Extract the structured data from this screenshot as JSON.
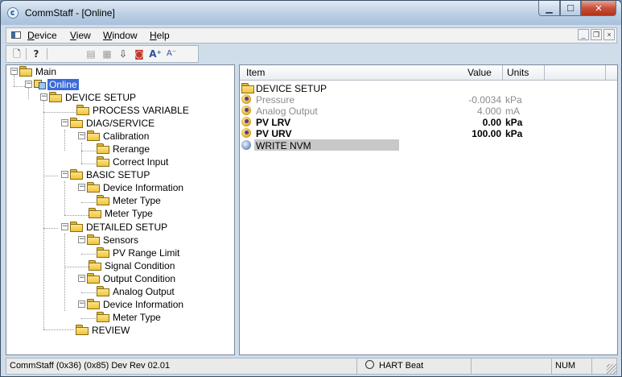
{
  "window": {
    "title": "CommStaff - [Online]"
  },
  "menubar": {
    "items": [
      "Device",
      "View",
      "Window",
      "Help"
    ]
  },
  "toolbar": {
    "buttons": [
      "new-icon",
      "help-icon",
      "read-icon",
      "write-icon",
      "download-icon",
      "red-device-icon",
      "font-larger-icon",
      "font-smaller-icon"
    ]
  },
  "tree": {
    "nodes": [
      {
        "label": "Main"
      },
      {
        "label": "Online"
      },
      {
        "label": "DEVICE SETUP"
      },
      {
        "label": "PROCESS VARIABLE"
      },
      {
        "label": "DIAG/SERVICE"
      },
      {
        "label": "Calibration"
      },
      {
        "label": "Rerange"
      },
      {
        "label": "Correct Input"
      },
      {
        "label": "BASIC SETUP"
      },
      {
        "label": "Device Information"
      },
      {
        "label": "Meter Type"
      },
      {
        "label": "Meter Type"
      },
      {
        "label": "DETAILED SETUP"
      },
      {
        "label": "Sensors"
      },
      {
        "label": "PV Range Limit"
      },
      {
        "label": "Signal Condition"
      },
      {
        "label": "Output Condition"
      },
      {
        "label": "Analog Output"
      },
      {
        "label": "Device Information"
      },
      {
        "label": "Meter Type"
      },
      {
        "label": "REVIEW"
      }
    ]
  },
  "list": {
    "headers": {
      "item": "Item",
      "value": "Value",
      "units": "Units"
    },
    "rows": [
      {
        "label": "DEVICE SETUP",
        "value": "",
        "units": ""
      },
      {
        "label": "Pressure",
        "value": "-0.0034",
        "units": "kPa"
      },
      {
        "label": "Analog Output",
        "value": "4.000",
        "units": "mA"
      },
      {
        "label": "PV LRV",
        "value": "0.00",
        "units": "kPa"
      },
      {
        "label": "PV URV",
        "value": "100.00",
        "units": "kPa"
      },
      {
        "label": "WRITE NVM",
        "value": "",
        "units": ""
      }
    ]
  },
  "statusbar": {
    "info": "CommStaff  (0x36)  (0x85) Dev Rev 02.01",
    "heartbeat": "HART Beat",
    "num": "NUM"
  }
}
